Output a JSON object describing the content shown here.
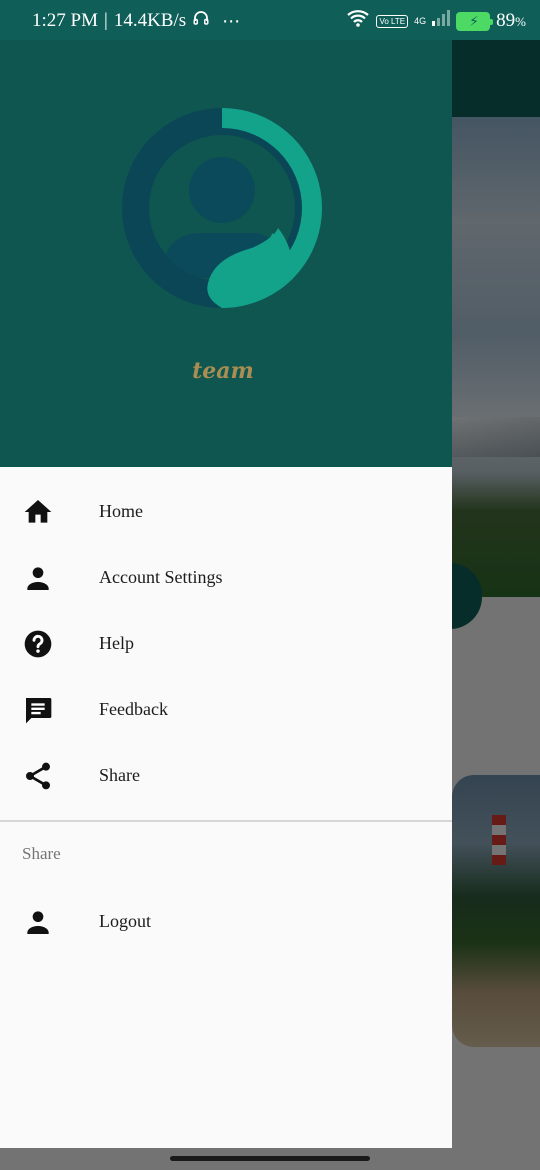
{
  "status_bar": {
    "time": "1:27 PM",
    "separator": "|",
    "speed": "14.4KB/s",
    "more": "⋯",
    "volte": "Vo LTE",
    "network": "4G",
    "battery_percent": "89",
    "percent_sign": "%",
    "battery_level": 0.89,
    "icons": [
      "headset-icon",
      "wifi-icon",
      "volte-icon",
      "signal-icon",
      "battery-icon"
    ]
  },
  "drawer": {
    "header": {
      "team_label": "team",
      "colors": {
        "background": "#0f5650",
        "accent": "#12a38a",
        "dark": "#0b4a54",
        "label": "#a98d52"
      }
    },
    "menu_items": [
      {
        "label": "Home",
        "icon": "home-icon"
      },
      {
        "label": "Account Settings",
        "icon": "person-icon"
      },
      {
        "label": "Help",
        "icon": "help-icon"
      },
      {
        "label": "Feedback",
        "icon": "feedback-icon"
      },
      {
        "label": "Share",
        "icon": "share-icon"
      }
    ],
    "section_header": "Share",
    "section_items": [
      {
        "label": "Logout",
        "icon": "person-icon"
      }
    ]
  },
  "colors": {
    "toolbar": "#0f5f58",
    "drawer_bg": "#fafafa"
  }
}
